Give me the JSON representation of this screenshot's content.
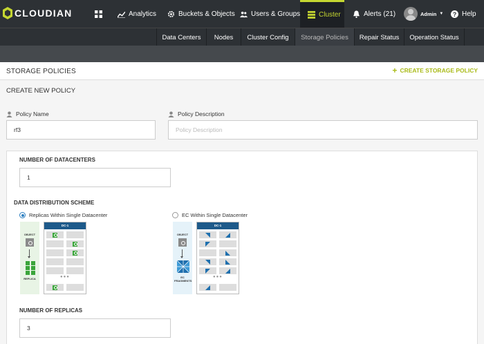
{
  "brand": {
    "name": "CLOUDIAN"
  },
  "nav": {
    "items": [
      {
        "label": "",
        "icon": "dashboard-grid-icon"
      },
      {
        "label": "Analytics",
        "icon": "analytics-chart-icon"
      },
      {
        "label": "Buckets & Objects",
        "icon": "gear-icon"
      },
      {
        "label": "Users & Groups",
        "icon": "users-icon"
      },
      {
        "label": "Cluster",
        "icon": "cluster-grid-icon",
        "active": true
      },
      {
        "label": "Alerts (21)",
        "icon": "bell-icon"
      }
    ],
    "user": {
      "name": "Admin"
    },
    "help": "Help"
  },
  "subnav": {
    "items": [
      "Data Centers",
      "Nodes",
      "Cluster Config",
      "Storage Policies",
      "Repair Status",
      "Operation Status"
    ],
    "active": "Storage Policies"
  },
  "header": {
    "title": "STORAGE POLICIES",
    "create_label": "CREATE STORAGE POLICY"
  },
  "form": {
    "section_title": "CREATE NEW POLICY",
    "policy_name": {
      "label": "Policy Name",
      "value": "rf3"
    },
    "policy_description": {
      "label": "Policy Description",
      "placeholder": "Policy Description",
      "value": ""
    },
    "datacenters": {
      "label": "NUMBER OF DATACENTERS",
      "value": "1"
    },
    "scheme": {
      "label": "DATA DISTRIBUTION SCHEME",
      "options": [
        {
          "label": "Replicas Within Single Datacenter",
          "checked": true
        },
        {
          "label": "EC Within Single Datacenter",
          "checked": false
        }
      ]
    },
    "replicas": {
      "label": "NUMBER OF REPLICAS",
      "value": "3"
    }
  },
  "diagrams": {
    "replica": {
      "object": "OBJECT",
      "caption": "REPLICA",
      "dc": "DC-1"
    },
    "ec": {
      "object": "OBJECT",
      "caption": "EC FRAGMENTS",
      "dc": "DC-1"
    }
  },
  "colors": {
    "nav_bg": "#2d3135",
    "accent": "#c5d631",
    "create_link": "#a9ba18",
    "radio_checked": "#2d7fc1",
    "replica_green": "#3aa53a",
    "ec_blue": "#1e6fae"
  }
}
